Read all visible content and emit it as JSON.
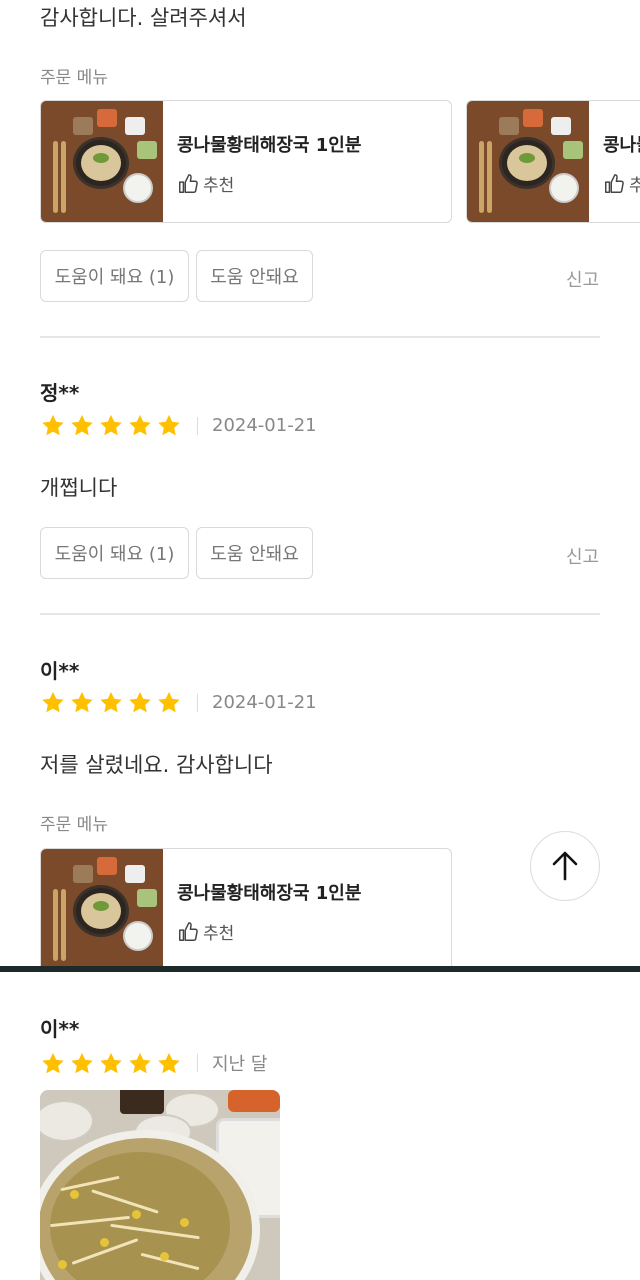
{
  "top_text": "감사합니다. 살려주셔서",
  "order_menu_label": "주문 메뉴",
  "menu_item": {
    "name": "콩나물황태해장국 1인분",
    "partial_name": "콩나물",
    "recommend": "추천"
  },
  "buttons": {
    "helpful": "도움이 돼요 (1)",
    "not_helpful": "도움 안돼요",
    "report": "신고"
  },
  "reviews": [
    {
      "reviewer": "정**",
      "rating": 5,
      "date": "2024-01-21",
      "text": "개쩝니다"
    },
    {
      "reviewer": "이**",
      "rating": 5,
      "date": "2024-01-21",
      "text": "저를 살렸네요. 감사합니다"
    },
    {
      "reviewer": "이**",
      "rating": 5,
      "date": "지난 달",
      "text": ""
    }
  ],
  "colors": {
    "star": "#FFC000",
    "divider": "#e6e6e6",
    "button_border": "#d6dadd"
  },
  "icons": {
    "thumb": "thumbs-up-icon",
    "star": "star-icon",
    "scroll_top": "arrow-up-icon"
  }
}
